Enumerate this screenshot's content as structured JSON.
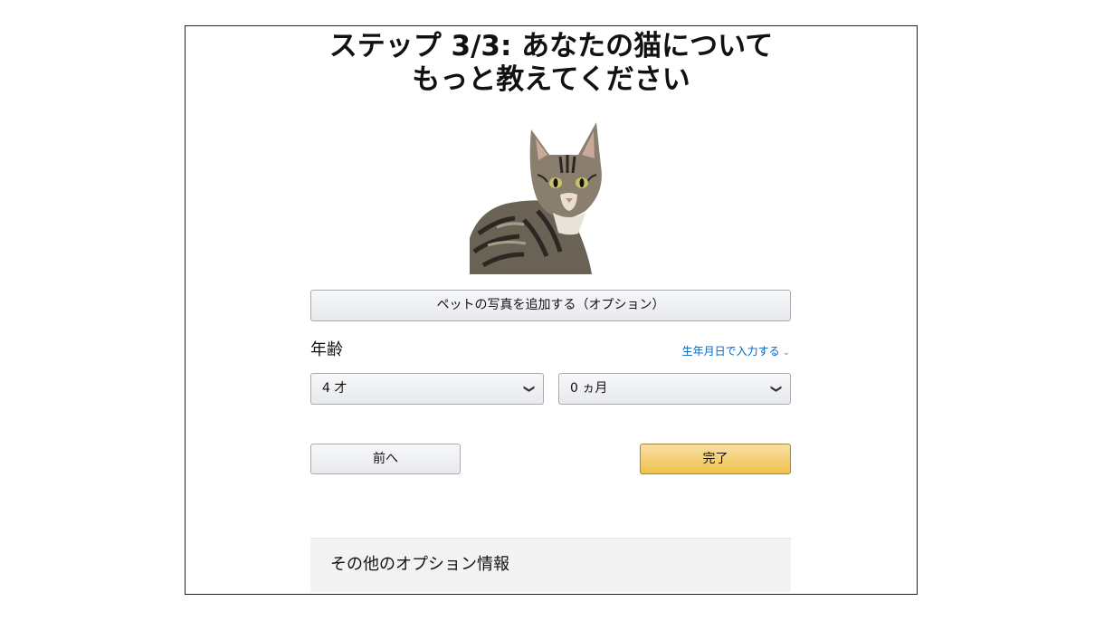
{
  "title": {
    "line1": "ステップ 3/3: あなたの猫について",
    "line2": "もっと教えてください"
  },
  "add_photo_button": "ペットの写真を追加する（オプション）",
  "age": {
    "label": "年齢",
    "birthdate_link": "生年月日で入力する",
    "years_value": "4 才",
    "months_value": "0 ヵ月"
  },
  "nav": {
    "prev_label": "前へ",
    "done_label": "完了"
  },
  "more_options": {
    "label": "その他のオプション情報"
  },
  "colors": {
    "done_button": "#f0c14b",
    "link": "#0066c0"
  }
}
